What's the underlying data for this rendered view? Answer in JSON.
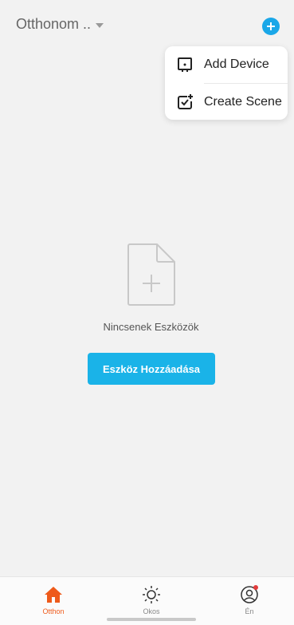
{
  "header": {
    "home_name": "Otthonom ..",
    "add_icon": "plus-circle-icon",
    "accent_color": "#1aa7e8"
  },
  "popup_menu": {
    "items": [
      {
        "label": "Add Device",
        "icon": "device-icon"
      },
      {
        "label": "Create Scene",
        "icon": "scene-check-icon"
      }
    ]
  },
  "empty_state": {
    "icon": "add-document-icon",
    "message": "Nincsenek Eszközök",
    "button_label": "Eszköz Hozzáadása",
    "button_color": "#1ab3e8"
  },
  "tabbar": {
    "active_color": "#ee5a1a",
    "tabs": [
      {
        "label": "Otthon",
        "icon": "home-icon",
        "active": true
      },
      {
        "label": "Okos",
        "icon": "sun-icon",
        "active": false
      },
      {
        "label": "Én",
        "icon": "profile-icon",
        "active": false,
        "notification_dot": true
      }
    ]
  }
}
